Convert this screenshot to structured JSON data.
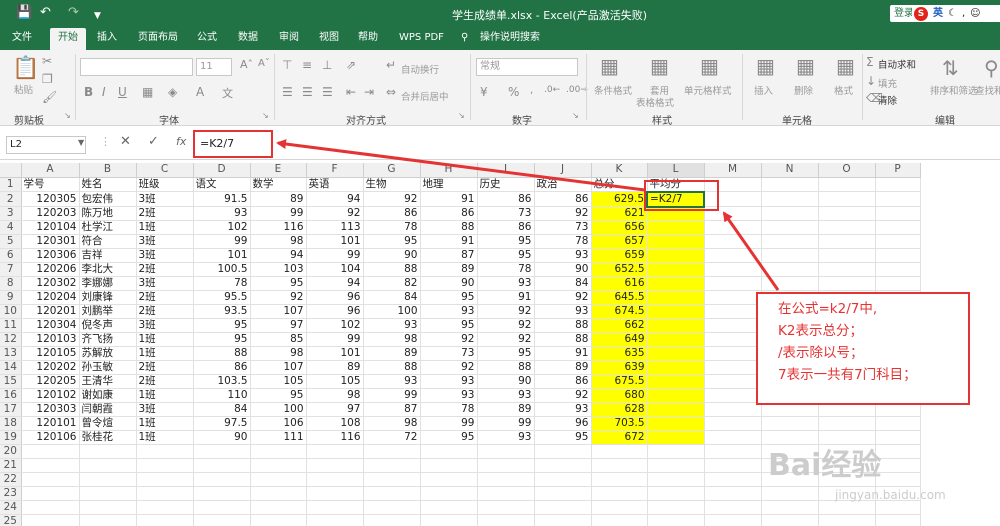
{
  "window": {
    "title": "学生成绩单.xlsx - Excel(产品激活失败)",
    "login": "登录",
    "ime_eng": "英"
  },
  "tabs": [
    "文件",
    "开始",
    "插入",
    "页面布局",
    "公式",
    "数据",
    "审阅",
    "视图",
    "帮助",
    "WPS PDF",
    "操作说明搜索"
  ],
  "ribbon": {
    "groups": [
      "剪贴板",
      "字体",
      "对齐方式",
      "数字",
      "样式",
      "单元格",
      "编辑"
    ],
    "paste": "粘贴",
    "font_size": "11",
    "wrap": "自动换行",
    "merge": "合并后居中",
    "number_format": "常规",
    "cond_format": "条件格式",
    "table_format": "套用\n表格格式",
    "cell_style": "单元格样式",
    "insert": "插入",
    "delete": "删除",
    "format": "格式",
    "autosum": "自动求和",
    "fill": "填充",
    "clear": "清除",
    "sort": "排序和筛选",
    "find": "查找和选择",
    "percent": "%"
  },
  "formula_bar": {
    "name_box": "L2",
    "formula": "=K2/7",
    "fx": "fx"
  },
  "columns": [
    "A",
    "B",
    "C",
    "D",
    "E",
    "F",
    "G",
    "H",
    "I",
    "J",
    "K",
    "L",
    "M",
    "N",
    "O",
    "P"
  ],
  "headers": [
    "学号",
    "姓名",
    "班级",
    "语文",
    "数学",
    "英语",
    "生物",
    "地理",
    "历史",
    "政治",
    "总分",
    "平均分"
  ],
  "rows": [
    [
      "120305",
      "包宏伟",
      "3班",
      "91.5",
      "89",
      "94",
      "92",
      "91",
      "86",
      "86",
      "629.5",
      "=K2/7"
    ],
    [
      "120203",
      "陈万地",
      "2班",
      "93",
      "99",
      "92",
      "86",
      "86",
      "73",
      "92",
      "621",
      ""
    ],
    [
      "120104",
      "杜学江",
      "1班",
      "102",
      "116",
      "113",
      "78",
      "88",
      "86",
      "73",
      "656",
      ""
    ],
    [
      "120301",
      "符合",
      "3班",
      "99",
      "98",
      "101",
      "95",
      "91",
      "95",
      "78",
      "657",
      ""
    ],
    [
      "120306",
      "吉祥",
      "3班",
      "101",
      "94",
      "99",
      "90",
      "87",
      "95",
      "93",
      "659",
      ""
    ],
    [
      "120206",
      "李北大",
      "2班",
      "100.5",
      "103",
      "104",
      "88",
      "89",
      "78",
      "90",
      "652.5",
      ""
    ],
    [
      "120302",
      "李娜娜",
      "3班",
      "78",
      "95",
      "94",
      "82",
      "90",
      "93",
      "84",
      "616",
      ""
    ],
    [
      "120204",
      "刘康锋",
      "2班",
      "95.5",
      "92",
      "96",
      "84",
      "95",
      "91",
      "92",
      "645.5",
      ""
    ],
    [
      "120201",
      "刘鹏举",
      "2班",
      "93.5",
      "107",
      "96",
      "100",
      "93",
      "92",
      "93",
      "674.5",
      ""
    ],
    [
      "120304",
      "倪冬声",
      "3班",
      "95",
      "97",
      "102",
      "93",
      "95",
      "92",
      "88",
      "662",
      ""
    ],
    [
      "120103",
      "齐飞扬",
      "1班",
      "95",
      "85",
      "99",
      "98",
      "92",
      "92",
      "88",
      "649",
      ""
    ],
    [
      "120105",
      "苏解放",
      "1班",
      "88",
      "98",
      "101",
      "89",
      "73",
      "95",
      "91",
      "635",
      ""
    ],
    [
      "120202",
      "孙玉敏",
      "2班",
      "86",
      "107",
      "89",
      "88",
      "92",
      "88",
      "89",
      "639",
      ""
    ],
    [
      "120205",
      "王清华",
      "2班",
      "103.5",
      "105",
      "105",
      "93",
      "93",
      "90",
      "86",
      "675.5",
      ""
    ],
    [
      "120102",
      "谢如康",
      "1班",
      "110",
      "95",
      "98",
      "99",
      "93",
      "93",
      "92",
      "680",
      ""
    ],
    [
      "120303",
      "闫朝霞",
      "3班",
      "84",
      "100",
      "97",
      "87",
      "78",
      "89",
      "93",
      "628",
      ""
    ],
    [
      "120101",
      "曾令煊",
      "1班",
      "97.5",
      "106",
      "108",
      "98",
      "99",
      "99",
      "96",
      "703.5",
      ""
    ],
    [
      "120106",
      "张桂花",
      "1班",
      "90",
      "111",
      "116",
      "72",
      "95",
      "93",
      "95",
      "672",
      ""
    ]
  ],
  "note": {
    "lines": [
      "在公式=k2/7中,",
      "K2表示总分；",
      "/表示除以号；",
      "7表示一共有7门科目；"
    ]
  },
  "watermark": {
    "brand": "Bai经验",
    "url": "jingyan.baidu.com"
  },
  "colors": {
    "excel_green": "#217346",
    "highlight": "#ffff00",
    "annotation": "#e53333"
  }
}
